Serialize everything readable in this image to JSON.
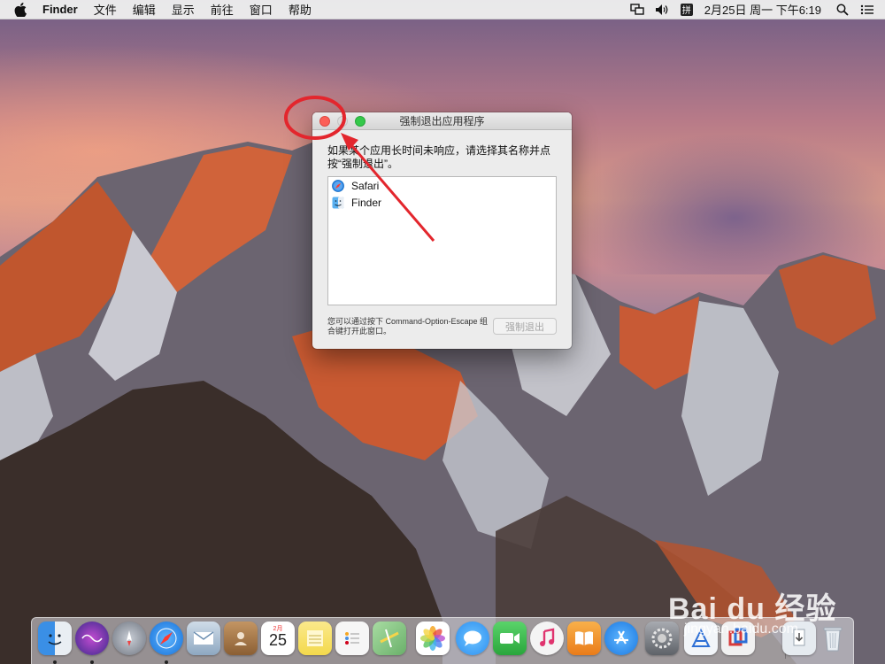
{
  "menubar": {
    "app_name": "Finder",
    "menus": [
      "文件",
      "编辑",
      "显示",
      "前往",
      "窗口",
      "帮助"
    ],
    "input_method": "拼",
    "clock": "2月25日 周一 下午6:19",
    "icons": [
      "apple-icon",
      "display-mirror-icon",
      "volume-icon",
      "input-method-icon",
      "spotlight-search-icon",
      "notification-center-icon"
    ]
  },
  "force_quit_window": {
    "title": "强制退出应用程序",
    "prompt": "如果某个应用长时间未响应，请选择其名称并点按“强制退出”。",
    "apps": [
      {
        "name": "Safari",
        "icon": "safari-icon"
      },
      {
        "name": "Finder",
        "icon": "finder-icon"
      }
    ],
    "hint": "您可以通过按下 Command-Option-Escape 组合键打开此窗口。",
    "force_quit_button": "强制退出",
    "force_quit_enabled": false
  },
  "dock": {
    "apps": [
      {
        "name": "Finder",
        "icon": "finder-icon",
        "running": true,
        "color": "#3d8be0"
      },
      {
        "name": "Siri",
        "icon": "siri-icon",
        "running": true,
        "color": "#6a4cc8"
      },
      {
        "name": "Launchpad",
        "icon": "launchpad-icon",
        "running": false,
        "color": "#8a8f99"
      },
      {
        "name": "Safari",
        "icon": "safari-icon",
        "running": true,
        "color": "#1e8cf0"
      },
      {
        "name": "Mail",
        "icon": "mail-icon",
        "running": false,
        "color": "#9fb4c8"
      },
      {
        "name": "Contacts",
        "icon": "contacts-icon",
        "running": false,
        "color": "#a87b4e"
      },
      {
        "name": "Calendar",
        "icon": "calendar-icon",
        "running": false,
        "color": "#ffffff",
        "month": "2月",
        "day": "25"
      },
      {
        "name": "Notes",
        "icon": "notes-icon",
        "running": false,
        "color": "#f6e27a"
      },
      {
        "name": "Reminders",
        "icon": "reminders-icon",
        "running": false,
        "color": "#f4f4f4"
      },
      {
        "name": "Maps",
        "icon": "maps-icon",
        "running": false,
        "color": "#7fc27a"
      },
      {
        "name": "Photos",
        "icon": "photos-icon",
        "running": false,
        "color": "#ffffff"
      },
      {
        "name": "Messages",
        "icon": "messages-icon",
        "running": false,
        "color": "#3aa7f5"
      },
      {
        "name": "FaceTime",
        "icon": "facetime-icon",
        "running": false,
        "color": "#39c452"
      },
      {
        "name": "iTunes",
        "icon": "itunes-icon",
        "running": false,
        "color": "#f3f3f3"
      },
      {
        "name": "iBooks",
        "icon": "ibooks-icon",
        "running": false,
        "color": "#f29a2e"
      },
      {
        "name": "App Store",
        "icon": "app-store-icon",
        "running": false,
        "color": "#2f8ff2"
      },
      {
        "name": "System Preferences",
        "icon": "system-preferences-icon",
        "running": false,
        "color": "#8e8e93"
      },
      {
        "name": "Xcode-like",
        "icon": "developer-icon",
        "running": false,
        "color": "#dfe8f2"
      },
      {
        "name": "Parallels",
        "icon": "parallels-icon",
        "running": false,
        "color": "#d83a3a"
      },
      {
        "name": "Downloads",
        "icon": "downloads-stack-icon",
        "running": false,
        "color": "#cfd6df"
      },
      {
        "name": "Trash",
        "icon": "trash-icon",
        "running": false,
        "color": "#dde3ea"
      }
    ]
  },
  "watermark": {
    "logo": "Bai du 经验",
    "url": "jingyan.baidu.com"
  }
}
